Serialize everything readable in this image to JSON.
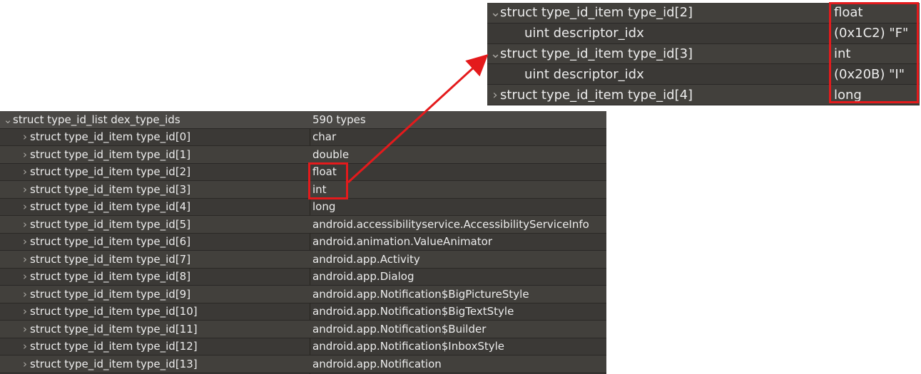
{
  "main_tree": {
    "header": {
      "name": "struct type_id_list dex_type_ids",
      "value": "590 types"
    },
    "rows": [
      {
        "name": "struct type_id_item type_id[0]",
        "value": "char"
      },
      {
        "name": "struct type_id_item type_id[1]",
        "value": "double"
      },
      {
        "name": "struct type_id_item type_id[2]",
        "value": "float"
      },
      {
        "name": "struct type_id_item type_id[3]",
        "value": "int"
      },
      {
        "name": "struct type_id_item type_id[4]",
        "value": "long"
      },
      {
        "name": "struct type_id_item type_id[5]",
        "value": "android.accessibilityservice.AccessibilityServiceInfo"
      },
      {
        "name": "struct type_id_item type_id[6]",
        "value": "android.animation.ValueAnimator"
      },
      {
        "name": "struct type_id_item type_id[7]",
        "value": "android.app.Activity"
      },
      {
        "name": "struct type_id_item type_id[8]",
        "value": "android.app.Dialog"
      },
      {
        "name": "struct type_id_item type_id[9]",
        "value": "android.app.Notification$BigPictureStyle"
      },
      {
        "name": "struct type_id_item type_id[10]",
        "value": "android.app.Notification$BigTextStyle"
      },
      {
        "name": "struct type_id_item type_id[11]",
        "value": "android.app.Notification$Builder"
      },
      {
        "name": "struct type_id_item type_id[12]",
        "value": "android.app.Notification$InboxStyle"
      },
      {
        "name": "struct type_id_item type_id[13]",
        "value": "android.app.Notification"
      }
    ]
  },
  "zoom_tree": {
    "rows": [
      {
        "name": "struct type_id_item type_id[2]",
        "value": "float",
        "expanded": true,
        "child": false
      },
      {
        "name": "uint descriptor_idx",
        "value": "(0x1C2) \"F\"",
        "expanded": false,
        "child": true
      },
      {
        "name": "struct type_id_item type_id[3]",
        "value": "int",
        "expanded": true,
        "child": false
      },
      {
        "name": "uint descriptor_idx",
        "value": "(0x20B) \"I\"",
        "expanded": false,
        "child": true
      },
      {
        "name": "struct type_id_item type_id[4]",
        "value": "long",
        "expanded": false,
        "child": false
      }
    ]
  },
  "icons": {
    "expanded": "chevron-down-icon",
    "collapsed": "chevron-right-icon"
  },
  "colors": {
    "panel": "#3b3936",
    "text": "#ececec",
    "highlight": "#e41a1c"
  }
}
